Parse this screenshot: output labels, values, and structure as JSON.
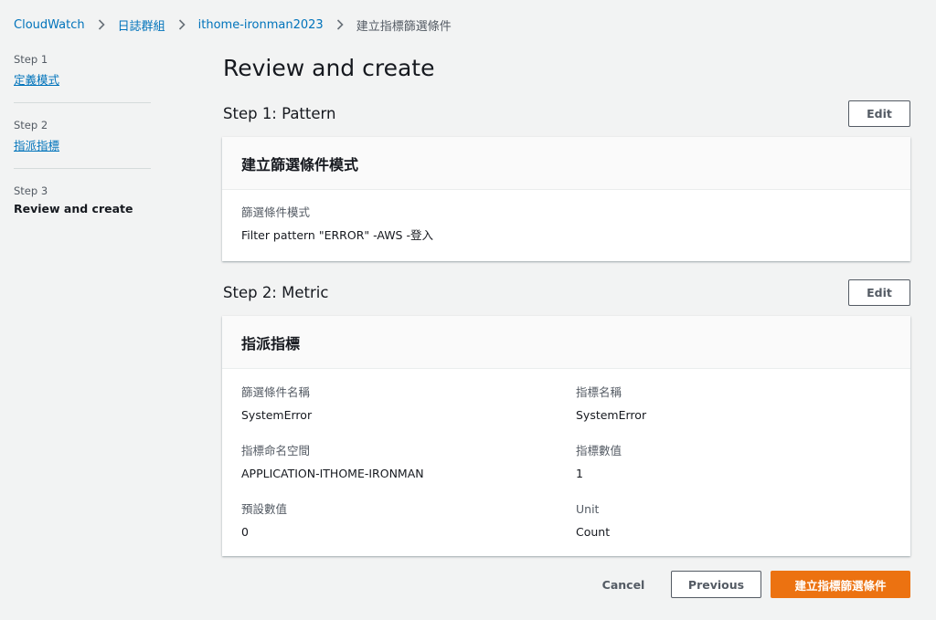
{
  "breadcrumb": {
    "items": [
      "CloudWatch",
      "日誌群組",
      "ithome-ironman2023"
    ],
    "current": "建立指標篩選條件"
  },
  "steps": [
    {
      "number": "Step 1",
      "label": "定義模式"
    },
    {
      "number": "Step 2",
      "label": "指派指標"
    },
    {
      "number": "Step 3",
      "label": "Review and create"
    }
  ],
  "page_title": "Review and create",
  "section1": {
    "title": "Step 1: Pattern",
    "edit_label": "Edit",
    "panel_title": "建立篩選條件模式",
    "field_label": "篩選條件模式",
    "field_value": "Filter pattern \"ERROR\" -AWS -登入"
  },
  "section2": {
    "title": "Step 2: Metric",
    "edit_label": "Edit",
    "panel_title": "指派指標",
    "fields": [
      {
        "label": "篩選條件名稱",
        "value": "SystemError"
      },
      {
        "label": "指標名稱",
        "value": "SystemError"
      },
      {
        "label": "指標命名空間",
        "value": "APPLICATION-ITHOME-IRONMAN"
      },
      {
        "label": "指標數值",
        "value": "1"
      },
      {
        "label": "預設數值",
        "value": "0"
      },
      {
        "label": "Unit",
        "value": "Count"
      }
    ]
  },
  "footer": {
    "cancel_label": "Cancel",
    "previous_label": "Previous",
    "submit_label": "建立指標篩選條件"
  },
  "colors": {
    "link": "#0073bb",
    "primary": "#ec7211",
    "background": "#f2f3f3"
  },
  "icons": {
    "breadcrumb_separator": "chevron-right-icon"
  }
}
